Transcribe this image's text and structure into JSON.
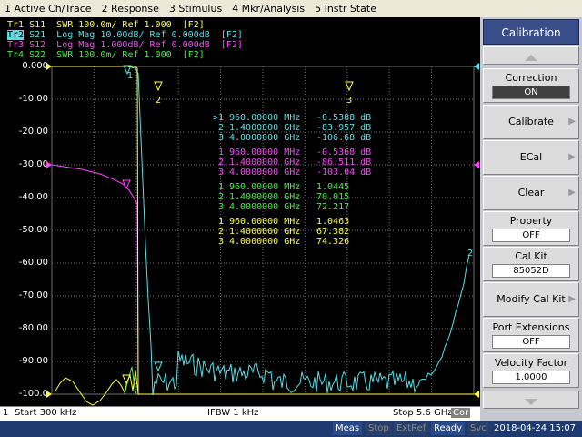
{
  "menu": [
    "1 Active Ch/Trace",
    "2 Response",
    "3 Stimulus",
    "4 Mkr/Analysis",
    "5 Instr State"
  ],
  "traces": [
    {
      "label": "Tr1",
      "text": " S11  SWR 100.0m/ Ref 1.000  [F2]",
      "color": "#ffff44"
    },
    {
      "label": "Tr2",
      "text": " S21  Log Mag 10.00dB/ Ref 0.000dB  [F2]",
      "color": "#55e0e8",
      "active": true
    },
    {
      "label": "Tr3",
      "text": " S12  Log Mag 1.000dB/ Ref 0.000dB  [F2]",
      "color": "#ff44ff"
    },
    {
      "label": "Tr4",
      "text": " S22  SWR 100.0m/ Ref 1.000  [F2]",
      "color": "#44ee44"
    }
  ],
  "y_labels": [
    "0.000",
    "-10.00",
    "-20.00",
    "-30.00",
    "-40.00",
    "-50.00",
    "-60.00",
    "-70.00",
    "-80.00",
    "-90.00",
    "-100.0"
  ],
  "marker_table": [
    {
      "color": "#55e0e8",
      "rows": [
        [
          ">1",
          "960.00000 MHz",
          "-0.5388 dB"
        ],
        [
          "2",
          "1.4000000 GHz",
          "-83.957 dB"
        ],
        [
          "3",
          "4.0000000 GHz",
          "-106.68 dB"
        ]
      ]
    },
    {
      "color": "#ff44ff",
      "rows": [
        [
          "1",
          "960.00000 MHz",
          "-0.5368 dB"
        ],
        [
          "2",
          "1.4000000 GHz",
          "-86.511 dB"
        ],
        [
          "3",
          "4.0000000 GHz",
          "-103.04 dB"
        ]
      ]
    },
    {
      "color": "#44ee44",
      "rows": [
        [
          "1",
          "960.00000 MHz",
          "1.0445"
        ],
        [
          "2",
          "1.4000000 GHz",
          "70.015"
        ],
        [
          "3",
          "4.0000000 GHz",
          "72.217"
        ]
      ]
    },
    {
      "color": "#ffff44",
      "rows": [
        [
          "1",
          "960.00000 MHz",
          "1.0463"
        ],
        [
          "2",
          "1.4000000 GHz",
          "67.382"
        ],
        [
          "3",
          "4.0000000 GHz",
          "74.326"
        ]
      ]
    }
  ],
  "marker_flags": [
    "2",
    "3",
    "1",
    "2"
  ],
  "status": {
    "channel": "1",
    "start": "Start 300 kHz",
    "ifbw": "IFBW 1 kHz",
    "stop": "Stop 5.6 GHz",
    "cor": "Cor",
    "meas": "Meas",
    "stop_btn": "Stop",
    "extref": "ExtRef",
    "ready": "Ready",
    "svc": "Svc",
    "datetime": "2018-04-24 15:07"
  },
  "softkeys": {
    "title": "Calibration",
    "correction": {
      "label": "Correction",
      "value": "ON"
    },
    "calibrate": "Calibrate",
    "ecal": "ECal",
    "clear": "Clear",
    "property": {
      "label": "Property",
      "value": "OFF"
    },
    "calkit": {
      "label": "Cal Kit",
      "value": "85052D"
    },
    "modify_calkit": "Modify Cal Kit",
    "port_ext": {
      "label": "Port Extensions",
      "value": "OFF"
    },
    "velocity": {
      "label": "Velocity Factor",
      "value": "1.0000"
    }
  },
  "colors": {
    "s11": "#ffff44",
    "s21": "#55e0e8",
    "s12": "#ff44ff",
    "s22": "#44ee44",
    "grid": "#707070"
  }
}
